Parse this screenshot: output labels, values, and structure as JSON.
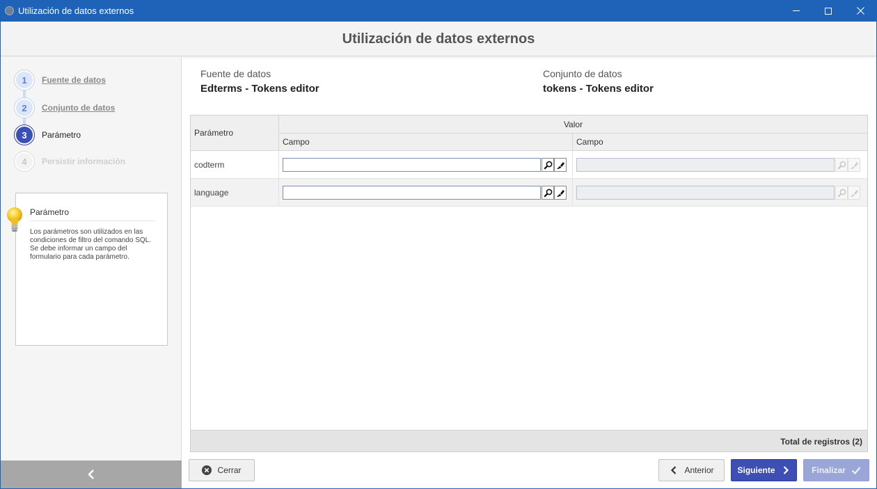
{
  "window": {
    "title": "Utilización de datos externos",
    "accent": "#1e63b8"
  },
  "header": {
    "title": "Utilización de datos externos"
  },
  "steps": [
    {
      "number": "1",
      "label": "Fuente de datos",
      "state": "done"
    },
    {
      "number": "2",
      "label": "Conjunto de datos",
      "state": "done"
    },
    {
      "number": "3",
      "label": "Parámetro",
      "state": "active"
    },
    {
      "number": "4",
      "label": "Persistir información",
      "state": "pending"
    }
  ],
  "help": {
    "icon": "lightbulb-icon",
    "title": "Parámetro",
    "text": "Los parámetros son utilizados en las condiciones de filtro del comando SQL. Se debe informar un campo del formulario para cada parámetro."
  },
  "info": {
    "source_label": "Fuente de datos",
    "source_value": "Edterms - Tokens editor",
    "dataset_label": "Conjunto de datos",
    "dataset_value": "tokens - Tokens editor"
  },
  "grid": {
    "col_param": "Parámetro",
    "col_valor": "Valor",
    "col_campo1": "Campo",
    "col_campo2": "Campo",
    "rows": [
      {
        "param": "codterm",
        "campo1": "",
        "campo2": ""
      },
      {
        "param": "language",
        "campo1": "",
        "campo2": ""
      }
    ],
    "total": "Total de registros (2)"
  },
  "buttons": {
    "cerrar": "Cerrar",
    "anterior": "Anterior",
    "siguiente": "Siguiente",
    "finalizar": "Finalizar"
  },
  "colors": {
    "primary": "#3d4eb5",
    "primary_disabled": "#9aa5d8",
    "step_active": "#3b4fb8"
  }
}
